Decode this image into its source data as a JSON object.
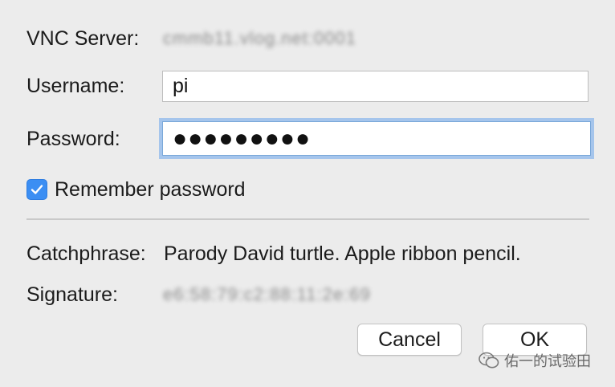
{
  "dialog": {
    "server_label": "VNC Server:",
    "server_value": "cmmb11.vlog.net:0001",
    "username_label": "Username:",
    "username_value": "pi",
    "password_label": "Password:",
    "password_value": "●●●●●●●●●",
    "remember_label": "Remember password",
    "remember_checked": true,
    "catchphrase_label": "Catchphrase:",
    "catchphrase_value": "Parody David turtle. Apple ribbon pencil.",
    "signature_label": "Signature:",
    "signature_value": "e6:58:79:c2:88:11:2e:69",
    "cancel_label": "Cancel",
    "ok_label": "OK"
  },
  "watermark": {
    "text": "佑一的试验田",
    "icon": "wechat-icon"
  },
  "colors": {
    "background": "#ececec",
    "focus_ring": "#a5c5ec",
    "checkbox_accent": "#3b8ef3"
  }
}
